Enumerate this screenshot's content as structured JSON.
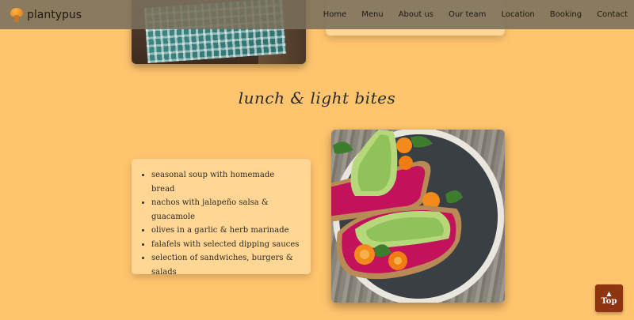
{
  "brand": {
    "name": "plantypus",
    "logo_icon": "mushroom-logo-icon"
  },
  "nav": {
    "items": [
      {
        "label": "Home"
      },
      {
        "label": "Menu"
      },
      {
        "label": "About us"
      },
      {
        "label": "Our team"
      },
      {
        "label": "Location"
      },
      {
        "label": "Booking"
      },
      {
        "label": "Contact"
      }
    ]
  },
  "section": {
    "title": "lunch & light bites",
    "items": [
      "seasonal soup with homemade bread",
      "nachos with jalapeño salsa & guacamole",
      "olives in a garlic & herb marinade",
      "falafels with selected dipping sauces",
      "selection of sandwiches, burgers & salads"
    ]
  },
  "top_button": {
    "label": "Top",
    "icon": "chevron-up-icon"
  },
  "colors": {
    "background": "#ffc56e",
    "card": "#ffd694",
    "header": "#7a705c",
    "top_button": "#8f3410"
  }
}
